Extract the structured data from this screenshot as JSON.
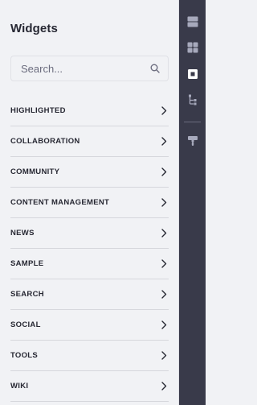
{
  "panel": {
    "title": "Widgets"
  },
  "search": {
    "placeholder": "Search...",
    "icon": "search-icon"
  },
  "categories": [
    {
      "label": "HIGHLIGHTED"
    },
    {
      "label": "COLLABORATION"
    },
    {
      "label": "COMMUNITY"
    },
    {
      "label": "CONTENT MANAGEMENT"
    },
    {
      "label": "NEWS"
    },
    {
      "label": "SAMPLE"
    },
    {
      "label": "SEARCH"
    },
    {
      "label": "SOCIAL"
    },
    {
      "label": "TOOLS"
    },
    {
      "label": "WIKI"
    }
  ],
  "rail": {
    "items": [
      {
        "icon": "fragments-icon"
      },
      {
        "icon": "widgets-icon",
        "active": true
      },
      {
        "icon": "page-structure-icon"
      },
      {
        "icon": "content-tree-icon"
      },
      {
        "icon": "look-and-feel-icon"
      }
    ]
  },
  "colors": {
    "panel_bg": "#f1f2f5",
    "rail_bg": "#393a4a",
    "text": "#272833",
    "icon": "#a7a9bc",
    "icon_active": "#ffffff"
  }
}
